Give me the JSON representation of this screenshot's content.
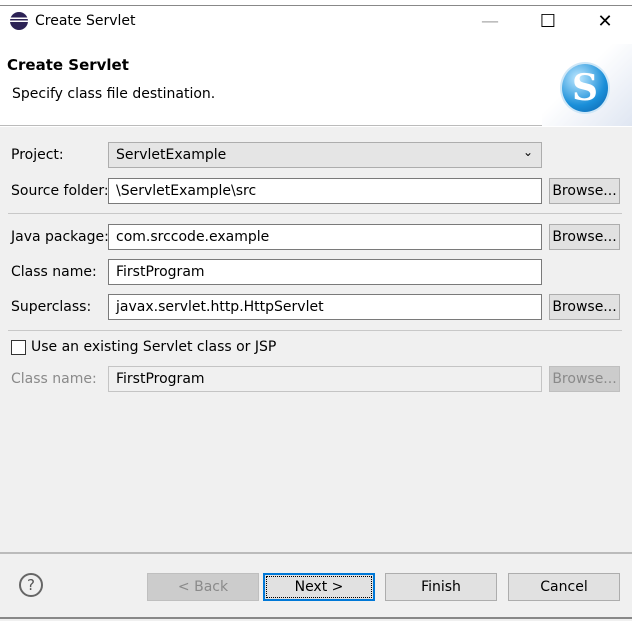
{
  "window": {
    "title": "Create Servlet",
    "minimize": "—",
    "maximize": "☐",
    "close": "✕"
  },
  "header": {
    "title": "Create Servlet",
    "subtitle": "Specify class file destination.",
    "logo_letter": "S"
  },
  "form": {
    "project": {
      "label": "Project:",
      "value": "ServletExample"
    },
    "source_folder": {
      "label": "Source folder:",
      "value": "\\ServletExample\\src",
      "browse": "Browse..."
    },
    "java_package": {
      "label": "Java package:",
      "value": "com.srccode.example",
      "browse": "Browse..."
    },
    "class_name": {
      "label": "Class name:",
      "value": "FirstProgram"
    },
    "superclass": {
      "label": "Superclass:",
      "value": "javax.servlet.http.HttpServlet",
      "browse": "Browse..."
    },
    "use_existing": {
      "label": "Use an existing Servlet class or JSP",
      "checked": false
    },
    "existing_class": {
      "label": "Class name:",
      "value": "FirstProgram",
      "browse": "Browse..."
    }
  },
  "footer": {
    "help": "?",
    "back": "< Back",
    "next": "Next >",
    "finish": "Finish",
    "cancel": "Cancel"
  }
}
